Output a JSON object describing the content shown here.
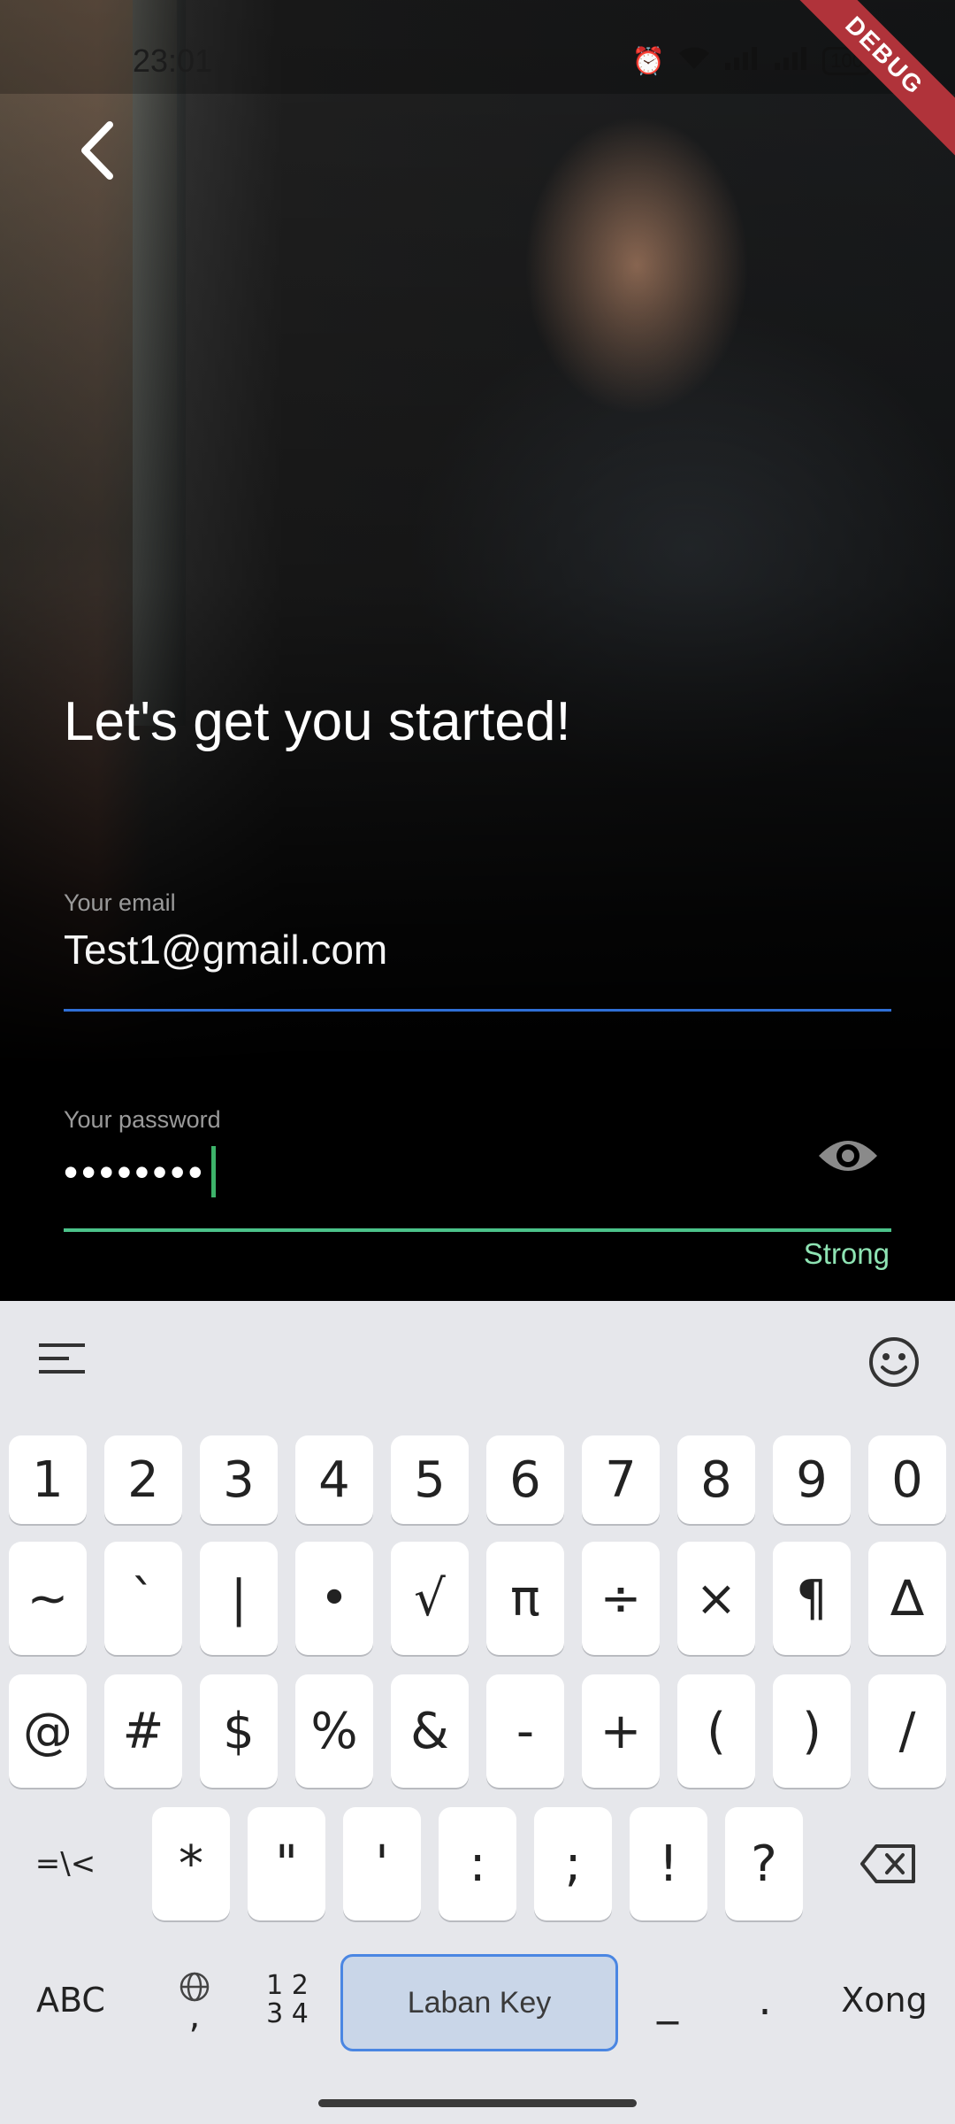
{
  "status_bar": {
    "time": "23:01",
    "battery": "100"
  },
  "debug_banner": "DEBUG",
  "page": {
    "title": "Let's get you started!"
  },
  "form": {
    "email": {
      "label": "Your email",
      "value": "Test1@gmail.com"
    },
    "password": {
      "label": "Your password",
      "value": "••••••••",
      "strength": "Strong"
    }
  },
  "keyboard": {
    "row1": [
      "1",
      "2",
      "3",
      "4",
      "5",
      "6",
      "7",
      "8",
      "9",
      "0"
    ],
    "row2": [
      "~",
      "`",
      "|",
      "•",
      "√",
      "π",
      "÷",
      "×",
      "¶",
      "∆"
    ],
    "row3": [
      "@",
      "#",
      "$",
      "%",
      "&",
      "-",
      "+",
      "(",
      ")",
      "/"
    ],
    "row4": [
      "=\\<",
      "*",
      "\"",
      "'",
      ":",
      ";",
      "!",
      "?"
    ],
    "bottom": {
      "abc": "ABC",
      "comma": ",",
      "num": "1 2\n3 4",
      "space": "Laban Key",
      "underscore": "_",
      "dot": ".",
      "done": "Xong"
    }
  },
  "colors": {
    "email_underline": "#2f6fd6",
    "password_underline": "#4bc38a",
    "strength": "#8ee3b3"
  }
}
